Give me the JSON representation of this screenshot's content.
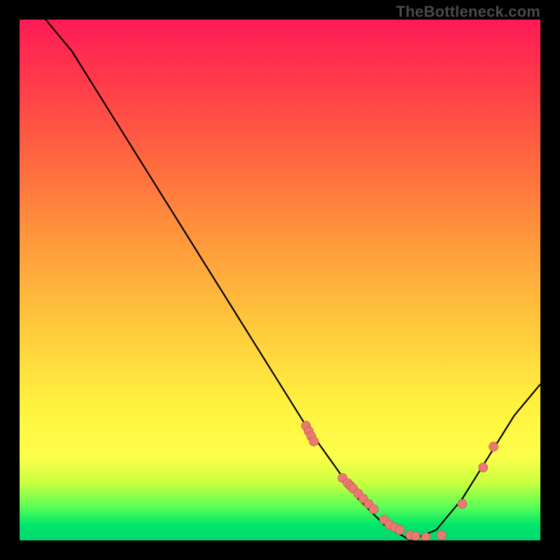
{
  "watermark": "TheBottleneck.com",
  "colors": {
    "frame_bg": "#000000",
    "curve": "#000000",
    "dot_fill": "#e87a72",
    "dot_stroke": "#cf5a52"
  },
  "chart_data": {
    "type": "line",
    "title": "",
    "xlabel": "",
    "ylabel": "",
    "xlim": [
      0,
      100
    ],
    "ylim": [
      0,
      100
    ],
    "curve": {
      "x": [
        5,
        10,
        15,
        20,
        25,
        30,
        35,
        40,
        45,
        50,
        55,
        60,
        65,
        70,
        75,
        80,
        85,
        90,
        95,
        100
      ],
      "y": [
        100,
        94,
        86,
        78,
        70,
        62,
        54,
        46,
        38,
        30,
        22,
        15,
        8,
        3,
        0,
        2,
        8,
        16,
        24,
        30
      ]
    },
    "series": [
      {
        "name": "points",
        "x": [
          55,
          55.5,
          56,
          56.5,
          62,
          63,
          63.5,
          64,
          65,
          66,
          67,
          68,
          70,
          71,
          72,
          73,
          75,
          76,
          78,
          81,
          85,
          89,
          91
        ],
        "y": [
          22,
          21,
          20,
          19,
          12,
          11,
          10.5,
          10,
          9,
          8,
          7,
          6,
          4,
          3,
          2.5,
          2,
          1,
          0.8,
          0.6,
          1,
          7,
          14,
          18
        ]
      }
    ]
  }
}
